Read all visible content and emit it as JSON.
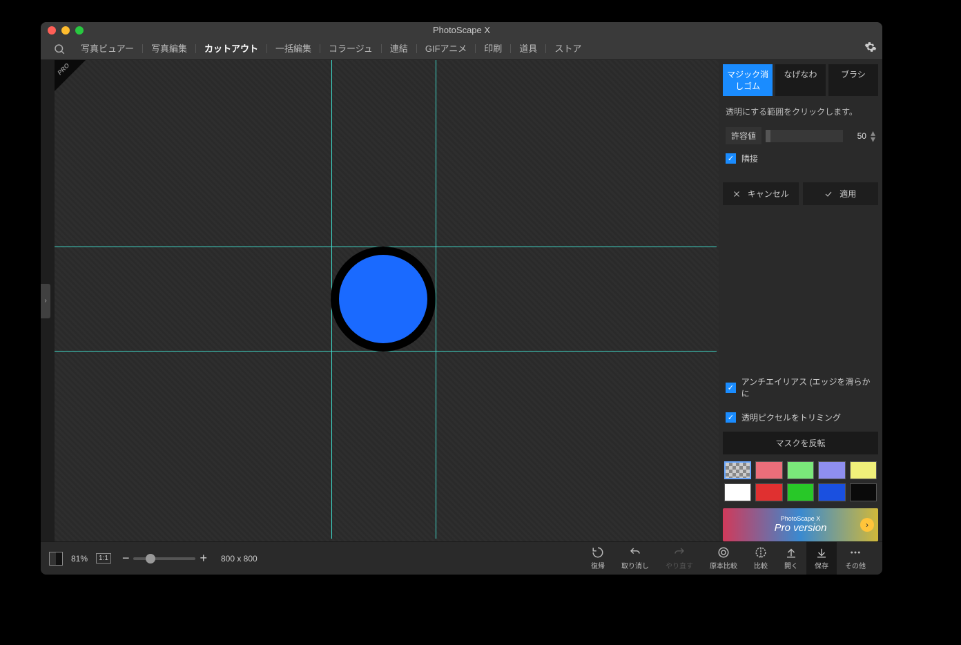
{
  "window": {
    "title": "PhotoScape X"
  },
  "tabs": [
    "写真ビュアー",
    "写真編集",
    "カットアウト",
    "一括編集",
    "コラージュ",
    "連結",
    "GIFアニメ",
    "印刷",
    "道具",
    "ストア"
  ],
  "activeTab": "カットアウト",
  "proBadge": "PRO",
  "toolTabs": {
    "magic": "マジック消しゴム",
    "lasso": "なげなわ",
    "brush": "ブラシ"
  },
  "hint": "透明にする範囲をクリックします。",
  "tolerance": {
    "label": "許容値",
    "value": "50"
  },
  "contiguous": "隣接",
  "cancel": "キャンセル",
  "apply": "適用",
  "antialias": "アンチエイリアス (エッジを滑らかに",
  "trim": "透明ピクセルをトリミング",
  "invertMask": "マスクを反転",
  "swatchColors": [
    "checker",
    "#eb6e7a",
    "#7ae87a",
    "#8f8ff0",
    "#f0f07a",
    "#ffffff",
    "#e03030",
    "#28c828",
    "#1a50e0",
    "#0a0a0a"
  ],
  "promo": {
    "small": "PhotoScape X",
    "big": "Pro version"
  },
  "zoom": {
    "percent": "81%",
    "ratio": "1:1",
    "dims": "800 x 800"
  },
  "actions": {
    "revert": "復帰",
    "undo": "取り消し",
    "redo": "やり直す",
    "original": "原本比較",
    "compare": "比較",
    "open": "開く",
    "save": "保存",
    "more": "その他"
  }
}
